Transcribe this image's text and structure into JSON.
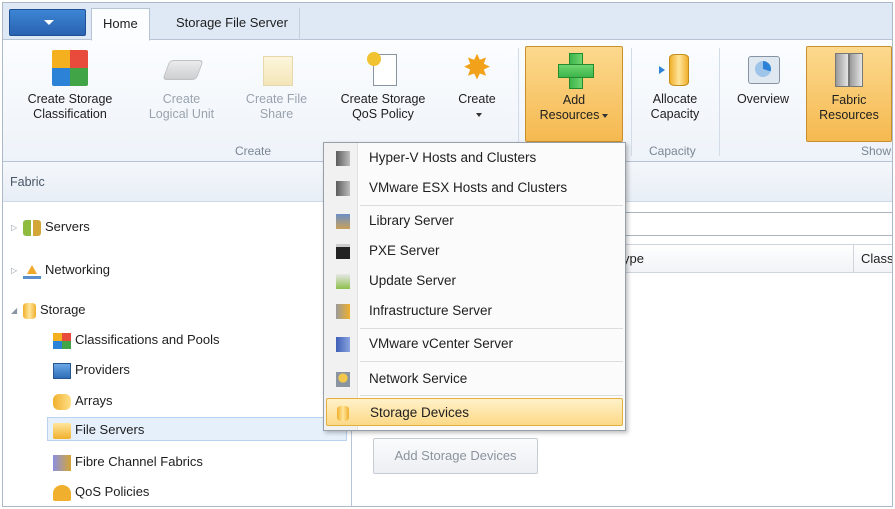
{
  "ribbon": {
    "tabs": [
      {
        "label": "Home"
      },
      {
        "label": "Storage File Server"
      }
    ],
    "buttons": {
      "create_storage_classification": [
        "Create Storage",
        "Classification"
      ],
      "create_logical_unit": [
        "Create",
        "Logical Unit"
      ],
      "create_file_share": [
        "Create File",
        "Share"
      ],
      "create_storage_qos_policy": [
        "Create Storage",
        "QoS Policy"
      ],
      "create": "Create",
      "add_resources": [
        "Add",
        "Resources"
      ],
      "allocate_capacity": [
        "Allocate",
        "Capacity"
      ],
      "overview": "Overview",
      "fabric_resources": [
        "Fabric",
        "Resources"
      ]
    },
    "groups": {
      "create": "Create",
      "capacity": "Capacity",
      "show": "Show"
    }
  },
  "nav": {
    "header": "Fabric",
    "items": [
      {
        "label": "Servers"
      },
      {
        "label": "Networking"
      },
      {
        "label": "Storage"
      },
      {
        "label": "Classifications and Pools"
      },
      {
        "label": "Providers"
      },
      {
        "label": "Arrays"
      },
      {
        "label": "File Servers"
      },
      {
        "label": "Fibre Channel Fabrics"
      },
      {
        "label": "QoS Policies"
      }
    ]
  },
  "content": {
    "columns": [
      "ype",
      "Class"
    ],
    "add_storage_devices_button": "Add Storage Devices"
  },
  "menu": {
    "items": [
      {
        "label": "Hyper-V Hosts and Clusters"
      },
      {
        "label": "VMware ESX Hosts and Clusters"
      },
      {
        "label": "Library Server"
      },
      {
        "label": "PXE Server"
      },
      {
        "label": "Update Server"
      },
      {
        "label": "Infrastructure Server"
      },
      {
        "label": "VMware vCenter Server"
      },
      {
        "label": "Network Service"
      },
      {
        "label": "Storage Devices"
      }
    ],
    "highlighted": "Storage Devices"
  },
  "colors": {
    "ribbon_tab_bg": "#dfe9f5",
    "file_tab": "#2a62b0",
    "hot_button": "#f8c86a",
    "menu_highlight": "#fcd987",
    "selected_row": "#e5f0fb"
  },
  "icons": {
    "create_storage_classification": "colored-grid-icon",
    "create_logical_unit": "disk-icon",
    "create_file_share": "file-share-icon",
    "create_storage_qos_policy": "qos-policy-icon",
    "create": "star-burst-icon",
    "add_resources": "green-plus-icon",
    "allocate_capacity": "storage-cylinder-icon",
    "overview": "overview-chart-icon",
    "fabric_resources": "server-rack-icon"
  }
}
